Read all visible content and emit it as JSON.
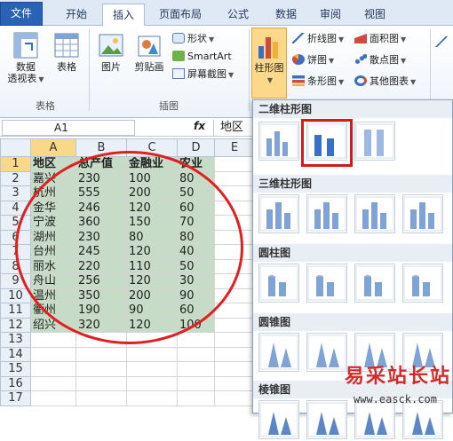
{
  "ribbon_tabs": [
    "文件",
    "开始",
    "插入",
    "页面布局",
    "公式",
    "数据",
    "审阅",
    "视图"
  ],
  "ribbon": {
    "pivot_line1": "数据",
    "pivot_line2": "透视表",
    "table": "表格",
    "picture": "图片",
    "clipart": "剪贴画",
    "shapes": "形状",
    "smartart": "SmartArt",
    "screenshot": "屏幕截图",
    "column_chart": "柱形图",
    "line": "折线图",
    "pie": "饼图",
    "bar": "条形图",
    "area": "面积图",
    "scatter": "散点图",
    "other": "其他图表",
    "groups": {
      "tables": "表格",
      "illustrations": "插图"
    }
  },
  "formula_bar": {
    "name_box": "A1",
    "fx": "fx",
    "value": "地区"
  },
  "sheet": {
    "columns": [
      "A",
      "B",
      "C",
      "D",
      "E"
    ],
    "rows": [
      [
        "地区",
        "总产值",
        "金融业",
        "农业"
      ],
      [
        "嘉兴",
        "230",
        "100",
        "80"
      ],
      [
        "杭州",
        "555",
        "200",
        "50"
      ],
      [
        "金华",
        "246",
        "120",
        "60"
      ],
      [
        "宁波",
        "360",
        "150",
        "70"
      ],
      [
        "湖州",
        "230",
        "80",
        "80"
      ],
      [
        "台州",
        "245",
        "120",
        "40"
      ],
      [
        "丽水",
        "220",
        "110",
        "50"
      ],
      [
        "舟山",
        "256",
        "120",
        "30"
      ],
      [
        "温州",
        "350",
        "200",
        "90"
      ],
      [
        "衢州",
        "190",
        "90",
        "60"
      ],
      [
        "绍兴",
        "320",
        "120",
        "100"
      ]
    ],
    "row_numbers": [
      "1",
      "2",
      "3",
      "4",
      "5",
      "6",
      "7",
      "8",
      "9",
      "10",
      "11",
      "12",
      "13",
      "14",
      "15",
      "16",
      "17"
    ]
  },
  "gallery": {
    "sections": [
      "二维柱形图",
      "三维柱形图",
      "圆柱图",
      "圆锥图",
      "棱锥图"
    ]
  },
  "watermark": {
    "title": "易采站长站",
    "url": "www.easck.com"
  },
  "colors": {
    "file_tab": "#2a62b8",
    "data_fill": "#c7dcc7",
    "highlight": "#e02020"
  }
}
